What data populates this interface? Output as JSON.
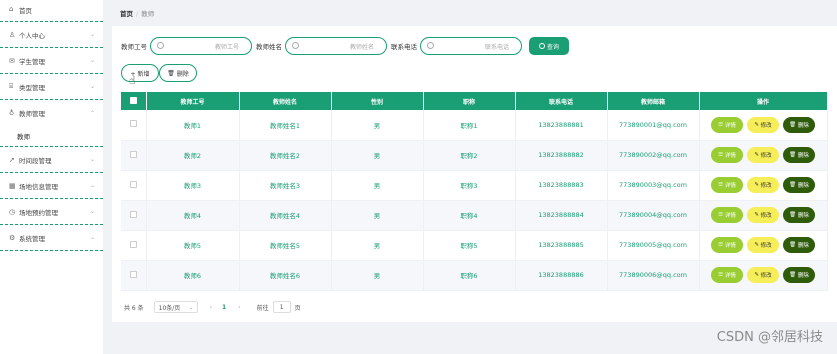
{
  "sidebar": {
    "items": [
      {
        "label": "首页",
        "icon": "home-icon"
      },
      {
        "label": "个人中心",
        "icon": "user-icon"
      },
      {
        "label": "学生管理",
        "icon": "mail-icon"
      },
      {
        "label": "类型管理",
        "icon": "bank-icon"
      },
      {
        "label": "教师管理",
        "icon": "mic-icon"
      },
      {
        "label": "时间段管理",
        "icon": "send-icon"
      },
      {
        "label": "场地信息管理",
        "icon": "grid-icon"
      },
      {
        "label": "场地预约管理",
        "icon": "clock-icon"
      },
      {
        "label": "系统管理",
        "icon": "gear-icon"
      }
    ],
    "sub_item": "教师"
  },
  "breadcrumb": {
    "home": "首页",
    "sep": "/",
    "current": "教师"
  },
  "search": {
    "label1": "教师工号",
    "placeholder1": "教师工号",
    "label2": "教师姓名",
    "placeholder2": "教师姓名",
    "label3": "联系电话",
    "placeholder3": "联系电话",
    "query_label": "查询"
  },
  "actions": {
    "add_label": "+ 新增",
    "delete_label": "删除"
  },
  "table": {
    "headers": [
      "教师工号",
      "教师姓名",
      "性别",
      "职称",
      "联系电话",
      "教师邮箱",
      "操作"
    ],
    "rows": [
      [
        "教师1",
        "教师姓名1",
        "男",
        "职称1",
        "13823888881",
        "773890001@qq.com"
      ],
      [
        "教师2",
        "教师姓名2",
        "男",
        "职称2",
        "13823888882",
        "773890002@qq.com"
      ],
      [
        "教师3",
        "教师姓名3",
        "男",
        "职称3",
        "13823888883",
        "773890003@qq.com"
      ],
      [
        "教师4",
        "教师姓名4",
        "男",
        "职称4",
        "13823888884",
        "773890004@qq.com"
      ],
      [
        "教师5",
        "教师姓名5",
        "男",
        "职称5",
        "13823888885",
        "773890005@qq.com"
      ],
      [
        "教师6",
        "教师姓名6",
        "男",
        "职称6",
        "13823888886",
        "773890006@qq.com"
      ]
    ],
    "op_detail": "详情",
    "op_edit": "修改",
    "op_delete": "删除"
  },
  "pagination": {
    "total": "共 6 条",
    "page_size": "10条/页",
    "prev": "‹",
    "current_page": "1",
    "next": "›",
    "goto_label": "前往",
    "goto_value": "1",
    "page_suffix": "页"
  },
  "watermark": "CSDN @邻居科技",
  "colors": {
    "accent": "#1a9e74",
    "detail": "#9acd32",
    "edit": "#f6ee59",
    "delete": "#2e5c0a"
  }
}
